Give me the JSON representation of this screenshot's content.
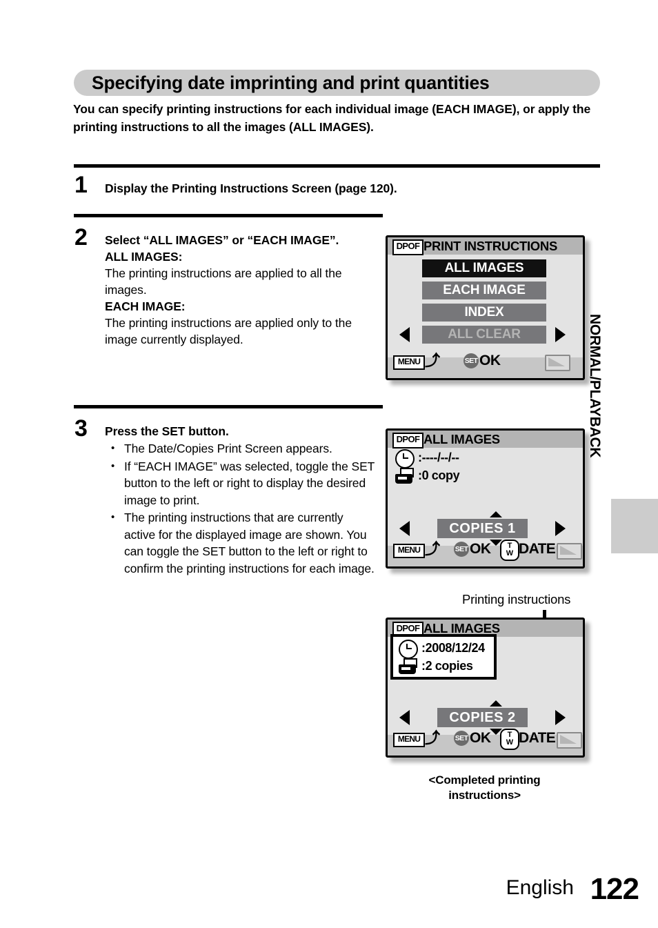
{
  "heading": "Specifying date imprinting and print quantities",
  "intro": "You can specify printing instructions for each individual image (EACH IMAGE), or apply the printing instructions to all the images (ALL IMAGES).",
  "steps": {
    "one": {
      "num": "1",
      "text": "Display the Printing Instructions Screen (page 120)."
    },
    "two": {
      "num": "2",
      "title": "Select “ALL IMAGES” or “EACH IMAGE”.",
      "label_all": "ALL IMAGES:",
      "desc_all": "The printing instructions are applied to all the images.",
      "label_each": "EACH IMAGE:",
      "desc_each": "The printing instructions are applied only to the image currently displayed."
    },
    "three": {
      "num": "3",
      "title": "Press the SET button.",
      "bullets": [
        "The Date/Copies Print Screen appears.",
        "If “EACH IMAGE” was selected, toggle the SET button to the left or right to display the desired image to print.",
        "The printing instructions that are currently active for the displayed image are shown. You can toggle the SET button to the left or right to confirm the printing instructions for each image."
      ]
    }
  },
  "screen1": {
    "dpof": "DPOF",
    "title": "PRINT INSTRUCTIONS",
    "items": [
      {
        "label": "ALL IMAGES",
        "state": "selected"
      },
      {
        "label": "EACH IMAGE",
        "state": "normal"
      },
      {
        "label": "INDEX",
        "state": "normal"
      },
      {
        "label": "ALL CLEAR",
        "state": "disabled"
      }
    ],
    "menu_btn": "MENU",
    "return_glyph": "⤴",
    "set_btn": "SET",
    "ok_label": "OK"
  },
  "screen2": {
    "dpof": "DPOF",
    "title": "ALL IMAGES",
    "date_value": ":----/--/--",
    "copies_value": ":0 copy",
    "copies_field": "COPIES  1",
    "menu_btn": "MENU",
    "return_glyph": "⤴",
    "set_btn": "SET",
    "ok_label": "OK",
    "tw_top": "T",
    "tw_bottom": "W",
    "date_label": "DATE"
  },
  "screen3": {
    "dpof": "DPOF",
    "title": "ALL IMAGES",
    "date_value": ":2008/12/24",
    "copies_value": ":2 copies",
    "copies_field": "COPIES  2",
    "menu_btn": "MENU",
    "return_glyph": "⤴",
    "set_btn": "SET",
    "ok_label": "OK",
    "tw_top": "T",
    "tw_bottom": "W",
    "date_label": "DATE",
    "callout_label": "Printing instructions",
    "caption_line1": "<Completed printing",
    "caption_line2": "instructions>"
  },
  "side_tab": "NORMAL/PLAYBACK",
  "footer": {
    "language": "English",
    "page": "122"
  },
  "colors": {
    "banner_gray": "#cbcbcb",
    "lcd_body": "#e3e3e3",
    "lcd_header": "#b4b4b4",
    "lcd_footer": "#c6c6c6",
    "menu_gray": "#77777a",
    "menu_selected": "#111111",
    "tab_gray": "#cccccc"
  }
}
